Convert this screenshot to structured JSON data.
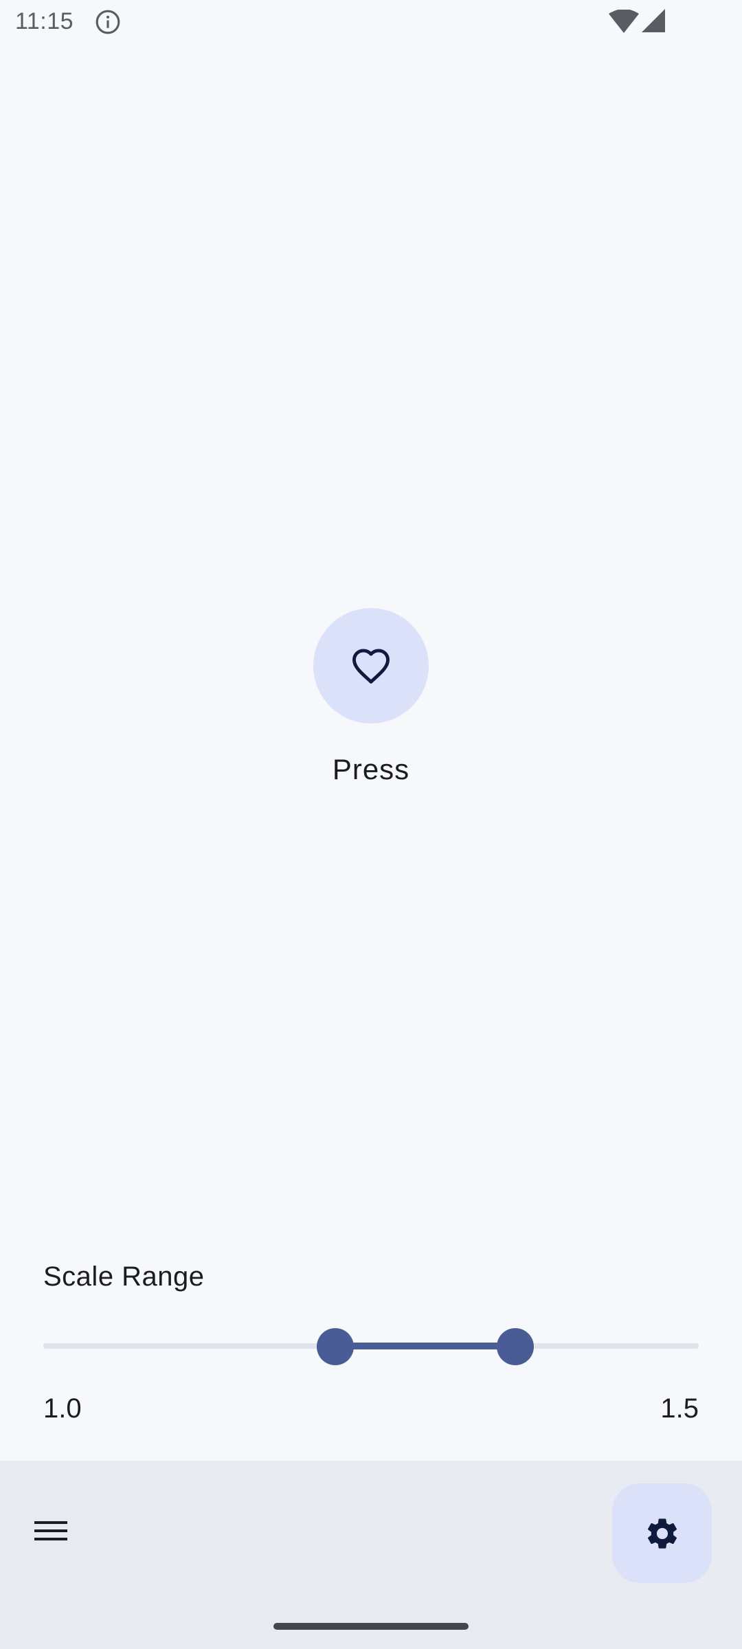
{
  "status_bar": {
    "time": "11:15",
    "icons": [
      "info-icon",
      "wifi-icon",
      "signal-icon"
    ]
  },
  "main": {
    "press_button_icon": "heart-outline-icon",
    "press_label": "Press"
  },
  "scale_range": {
    "title": "Scale Range",
    "min_label": "1.0",
    "max_label": "1.5",
    "lower_value_fraction": 0.445,
    "upper_value_fraction": 0.72
  },
  "bottom_bar": {
    "menu_icon": "menu-icon",
    "fab_icon": "gear-icon"
  },
  "colors": {
    "background": "#F7F8FC",
    "accent": "#4A5C96",
    "accent_container": "#DCE1FA",
    "bottom_bar": "#E9EBF3",
    "track_inactive": "#E0E2EC"
  }
}
